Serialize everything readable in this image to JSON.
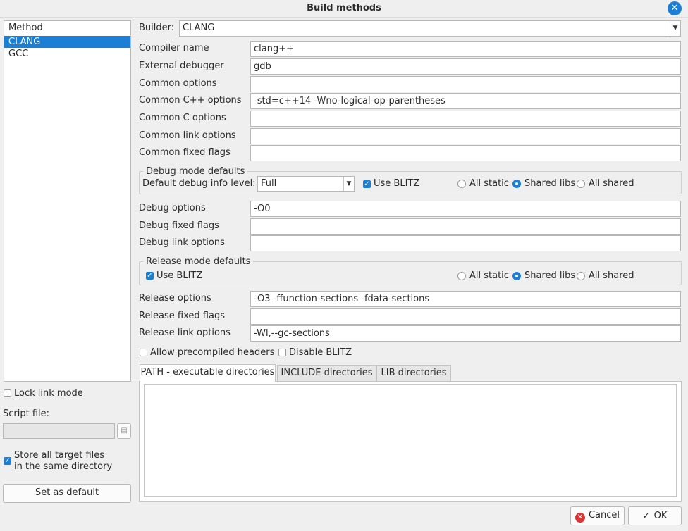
{
  "window": {
    "title": "Build methods"
  },
  "method_list": {
    "header": "Method",
    "items": [
      {
        "label": "CLANG",
        "selected": true
      },
      {
        "label": "GCC",
        "selected": false
      }
    ]
  },
  "left_panel": {
    "lock_link_mode": {
      "label": "Lock link mode",
      "checked": false
    },
    "script_file_label": "Script file:",
    "script_file_value": "",
    "store_target": {
      "label_line1": "Store all target files",
      "label_line2": "in the same directory",
      "checked": true
    },
    "set_default": "Set as default"
  },
  "builder": {
    "label": "Builder:",
    "value": "CLANG"
  },
  "fields": {
    "compiler_name": {
      "label": "Compiler name",
      "value": "clang++"
    },
    "external_debugger": {
      "label": "External debugger",
      "value": "gdb"
    },
    "common_options": {
      "label": "Common options",
      "value": ""
    },
    "common_cpp_options": {
      "label": "Common C++ options",
      "value": "-std=c++14 -Wno-logical-op-parentheses"
    },
    "common_c_options": {
      "label": "Common C options",
      "value": ""
    },
    "common_link_options": {
      "label": "Common link options",
      "value": ""
    },
    "common_fixed_flags": {
      "label": "Common fixed flags",
      "value": ""
    },
    "debug_options": {
      "label": "Debug options",
      "value": "-O0"
    },
    "debug_fixed_flags": {
      "label": "Debug fixed flags",
      "value": ""
    },
    "debug_link_options": {
      "label": "Debug link options",
      "value": ""
    },
    "release_options": {
      "label": "Release options",
      "value": "-O3 -ffunction-sections -fdata-sections"
    },
    "release_fixed_flags": {
      "label": "Release fixed flags",
      "value": ""
    },
    "release_link_options": {
      "label": "Release link options",
      "value": "-Wl,--gc-sections"
    }
  },
  "debug_group": {
    "title": "Debug mode defaults",
    "level_label": "Default debug info level:",
    "level_value": "Full",
    "use_blitz": {
      "label": "Use BLITZ",
      "checked": true
    },
    "radios": [
      {
        "label": "All static",
        "checked": false
      },
      {
        "label": "Shared libs",
        "checked": true
      },
      {
        "label": "All shared",
        "checked": false
      }
    ]
  },
  "release_group": {
    "title": "Release mode defaults",
    "use_blitz": {
      "label": "Use BLITZ",
      "checked": true
    },
    "radios": [
      {
        "label": "All static",
        "checked": false
      },
      {
        "label": "Shared libs",
        "checked": true
      },
      {
        "label": "All shared",
        "checked": false
      }
    ]
  },
  "options": {
    "allow_precompiled": {
      "label": "Allow precompiled headers",
      "checked": false
    },
    "disable_blitz": {
      "label": "Disable BLITZ",
      "checked": false
    }
  },
  "tabs": [
    {
      "label": "PATH - executable directories",
      "active": true
    },
    {
      "label": "INCLUDE directories",
      "active": false
    },
    {
      "label": "LIB directories",
      "active": false
    }
  ],
  "buttons": {
    "cancel": "Cancel",
    "ok": "OK"
  },
  "colors": {
    "accent": "#1b7fd6",
    "cancel_icon": "#dd3333"
  }
}
